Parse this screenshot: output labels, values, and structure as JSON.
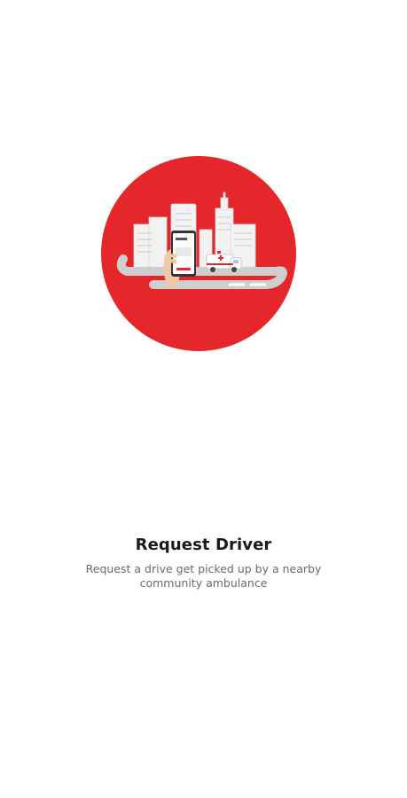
{
  "onboarding": {
    "title": "Request Driver",
    "description": "Request a drive get picked up by a nearby community ambulance"
  },
  "illustration": {
    "icon": "city-ambulance-request-illustration",
    "circle_color": "#e5262b",
    "road_color": "#cfcfcf",
    "building_color": "#f2f2f2",
    "phone_screen_label": "REQUEST"
  },
  "colors": {
    "title": "#1a1a1a",
    "description": "#6b6b6b",
    "background": "#ffffff",
    "accent": "#e5262b"
  }
}
